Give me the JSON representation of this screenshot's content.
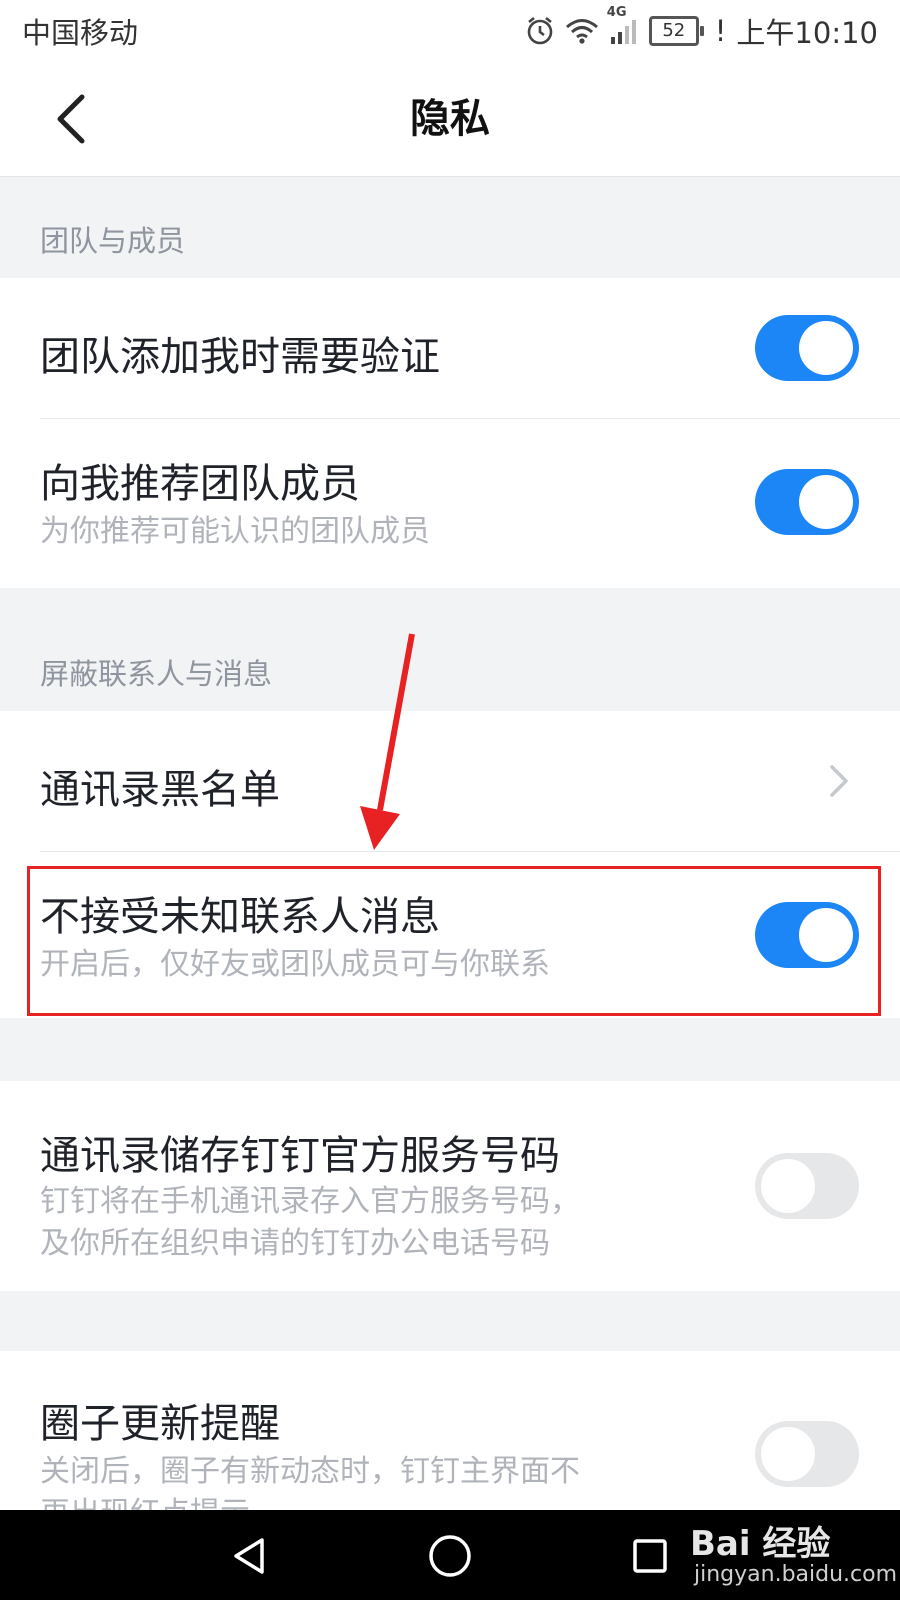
{
  "status_bar": {
    "carrier": "中国移动",
    "network": "4G",
    "battery": "52",
    "alert": "!",
    "time": "上午10:10",
    "icons": [
      "alarm-icon",
      "wifi-icon",
      "signal-icon",
      "battery-icon"
    ]
  },
  "navbar": {
    "title": "隐私",
    "back_icon": "chevron-left-icon"
  },
  "sections": [
    {
      "header": "团队与成员",
      "items": [
        {
          "title": "团队添加我时需要验证",
          "toggle": true
        },
        {
          "title": "向我推荐团队成员",
          "subtitle": "为你推荐可能认识的团队成员",
          "toggle": true
        }
      ]
    },
    {
      "header": "屏蔽联系人与消息",
      "items": [
        {
          "title": "通讯录黑名单",
          "chevron": true
        },
        {
          "title": "不接受未知联系人消息",
          "subtitle": "开启后，仅好友或团队成员可与你联系",
          "toggle": true,
          "highlighted": true
        }
      ]
    },
    {
      "items": [
        {
          "title": "通讯录储存钉钉官方服务号码",
          "subtitle_lines": [
            "钉钉将在手机通讯录存入官方服务号码，",
            "及你所在组织申请的钉钉办公电话号码"
          ],
          "toggle": false
        }
      ]
    },
    {
      "items": [
        {
          "title": "圈子更新提醒",
          "subtitle_lines": [
            "关闭后，圈子有新动态时，钉钉主界面不",
            "再出现红点提示"
          ],
          "toggle": false
        }
      ]
    }
  ],
  "system_nav": {
    "buttons": [
      "back-triangle-icon",
      "home-circle-icon",
      "recents-square-icon"
    ]
  },
  "watermark": {
    "brand": "Bai 经验",
    "url": "jingyan.baidu.com"
  },
  "colors": {
    "accent": "#1d86f7",
    "highlight": "#e82223",
    "toggle_off": "#e6e7e9",
    "background": "#f2f3f5"
  }
}
